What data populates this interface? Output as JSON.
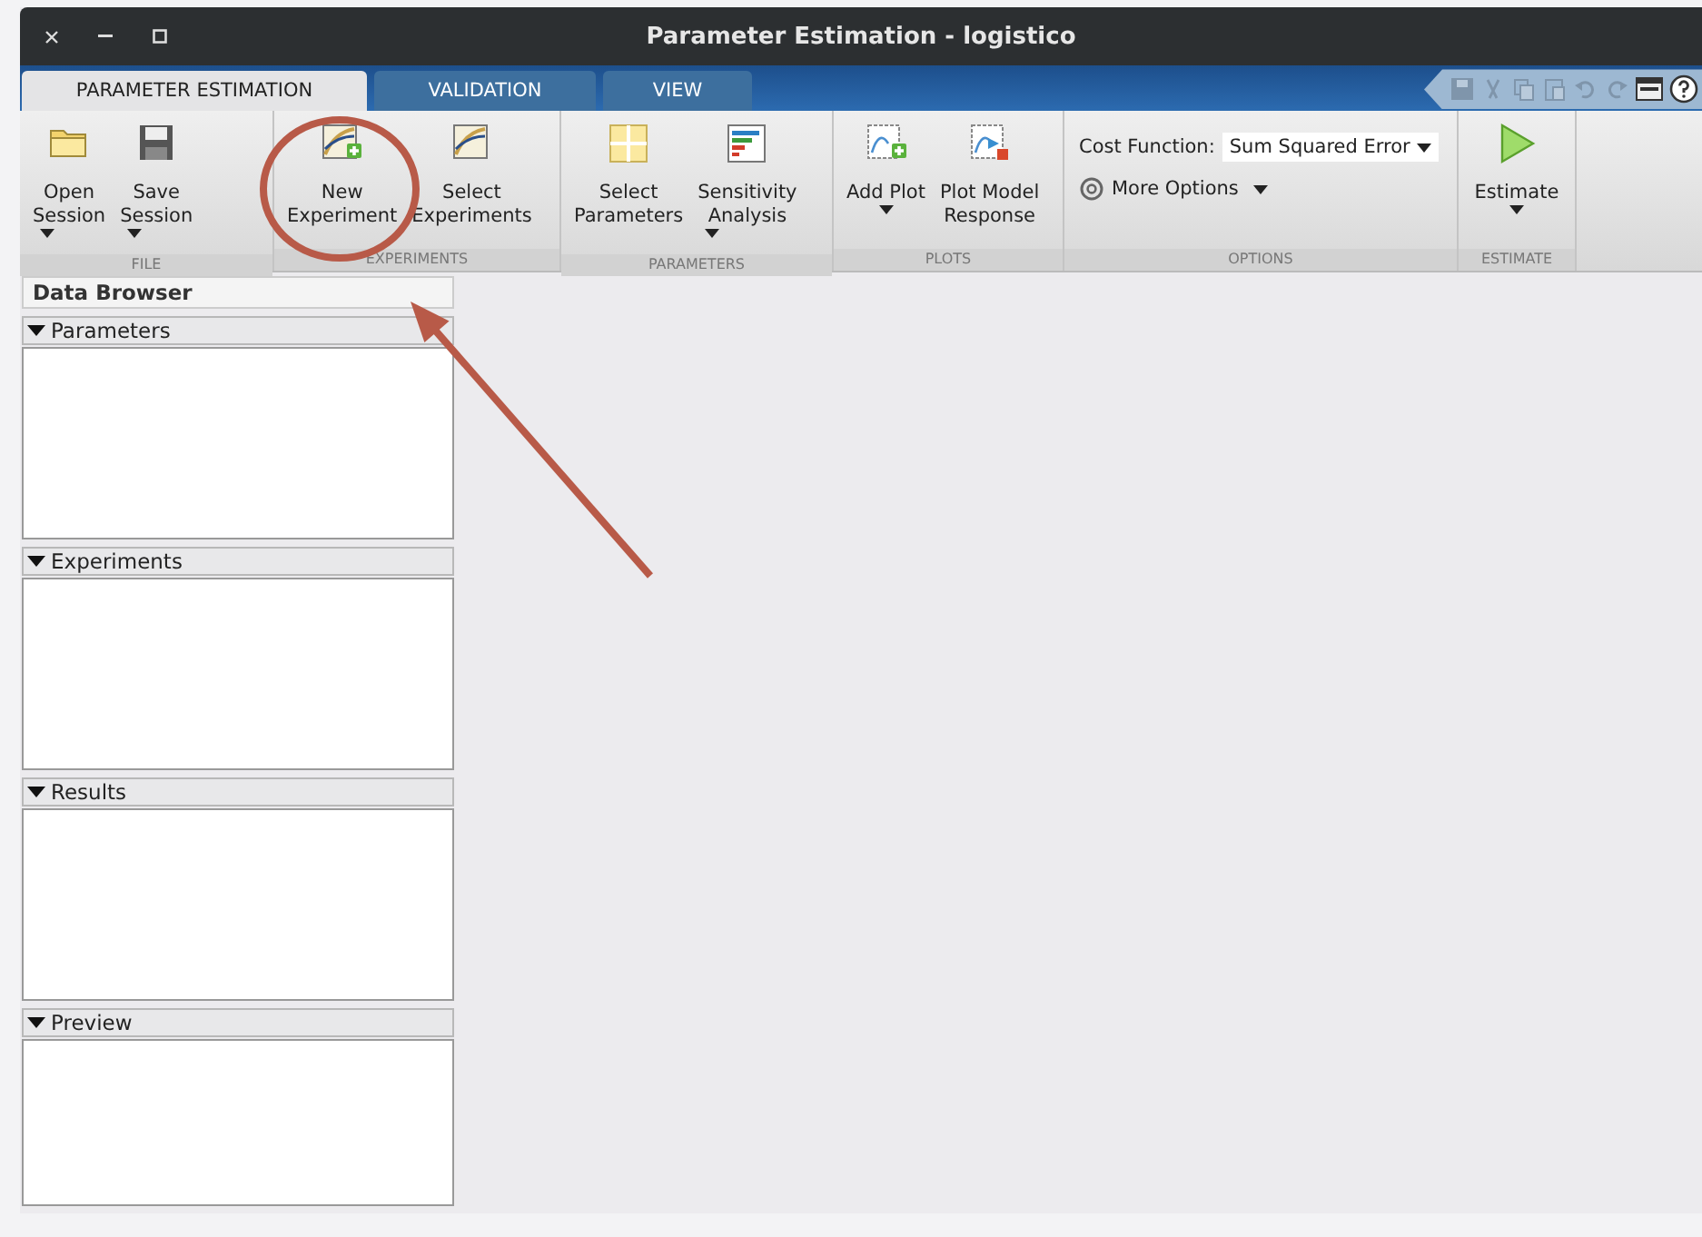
{
  "window": {
    "title": "Parameter Estimation - logistico"
  },
  "tabs": [
    {
      "label": "PARAMETER ESTIMATION",
      "selected": true
    },
    {
      "label": "VALIDATION",
      "selected": false
    },
    {
      "label": "VIEW",
      "selected": false
    }
  ],
  "toolbar": {
    "groups": [
      {
        "label": "FILE",
        "items": [
          {
            "kind": "button",
            "label": [
              "Open",
              "Session"
            ],
            "has_menu": true
          },
          {
            "kind": "button",
            "label": [
              "Save",
              "Session"
            ],
            "has_menu": true
          }
        ]
      },
      {
        "label": "EXPERIMENTS",
        "items": [
          {
            "kind": "button",
            "label": [
              "New",
              "Experiment"
            ],
            "has_menu": false
          },
          {
            "kind": "button",
            "label": [
              "Select",
              "Experiments"
            ],
            "has_menu": false
          }
        ]
      },
      {
        "label": "PARAMETERS",
        "items": [
          {
            "kind": "button",
            "label": [
              "Select",
              "Parameters"
            ],
            "has_menu": false
          },
          {
            "kind": "button",
            "label": [
              "Sensitivity",
              "Analysis"
            ],
            "has_menu": true
          }
        ]
      },
      {
        "label": "PLOTS",
        "items": [
          {
            "kind": "button",
            "label": [
              "Add Plot"
            ],
            "has_menu": true
          },
          {
            "kind": "button",
            "label": [
              "Plot Model",
              "Response"
            ],
            "has_menu": false
          }
        ]
      },
      {
        "label": "OPTIONS",
        "items": [
          {
            "kind": "dropdown",
            "label": "Cost Function:",
            "value": "Sum Squared Error"
          },
          {
            "kind": "menu",
            "label": "More Options"
          }
        ]
      },
      {
        "label": "ESTIMATE",
        "items": [
          {
            "kind": "button",
            "label": [
              "Estimate"
            ],
            "has_menu": true
          }
        ]
      }
    ]
  },
  "data_browser": {
    "title": "Data Browser",
    "sections": [
      {
        "label": "Parameters",
        "expanded": true
      },
      {
        "label": "Experiments",
        "expanded": true
      },
      {
        "label": "Results",
        "expanded": true
      },
      {
        "label": "Preview",
        "expanded": true
      }
    ]
  }
}
